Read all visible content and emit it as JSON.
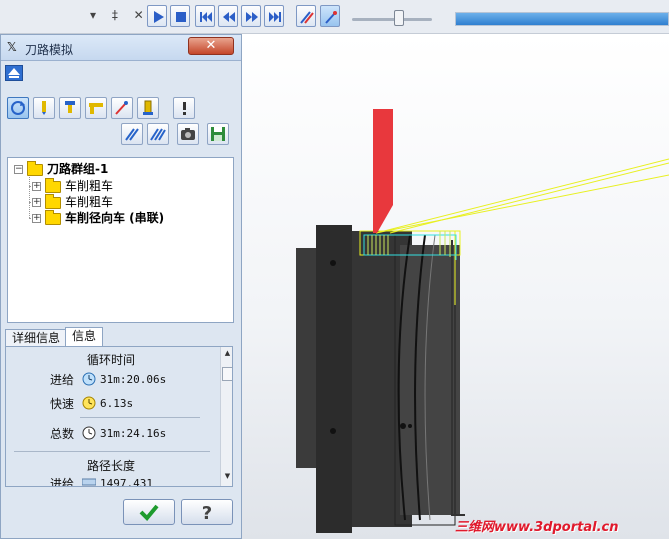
{
  "panel": {
    "title": "刀路模拟"
  },
  "tree": {
    "root": "刀路群组-1",
    "children": [
      {
        "label": "车削粗车"
      },
      {
        "label": "车削粗车"
      },
      {
        "label": "车削径向车 (串联)"
      }
    ]
  },
  "tabs": [
    {
      "label": "详细信息"
    },
    {
      "label": "信息"
    }
  ],
  "info": {
    "cycle_time_heading": "循环时间",
    "feed_label": "进给",
    "feed_value": "31m:20.06s",
    "rapid_label": "快速",
    "rapid_value": "6.13s",
    "total_label": "总数",
    "total_value": "31m:24.16s",
    "path_length_heading": "路径长度",
    "path_feed_label": "进给",
    "path_feed_value": "1497.431"
  },
  "playback": {
    "slider_value_fraction": 0.6,
    "progress_fraction": 1.0
  },
  "watermark": "三维网www.3dportal.cn",
  "colors": {
    "tool": "#e8383d",
    "toolpath": "#e8f020",
    "part": "#3a3a3a",
    "accent": "#2f7fd0"
  },
  "icons": {
    "ok": "checkmark-icon",
    "help": "question-icon"
  }
}
